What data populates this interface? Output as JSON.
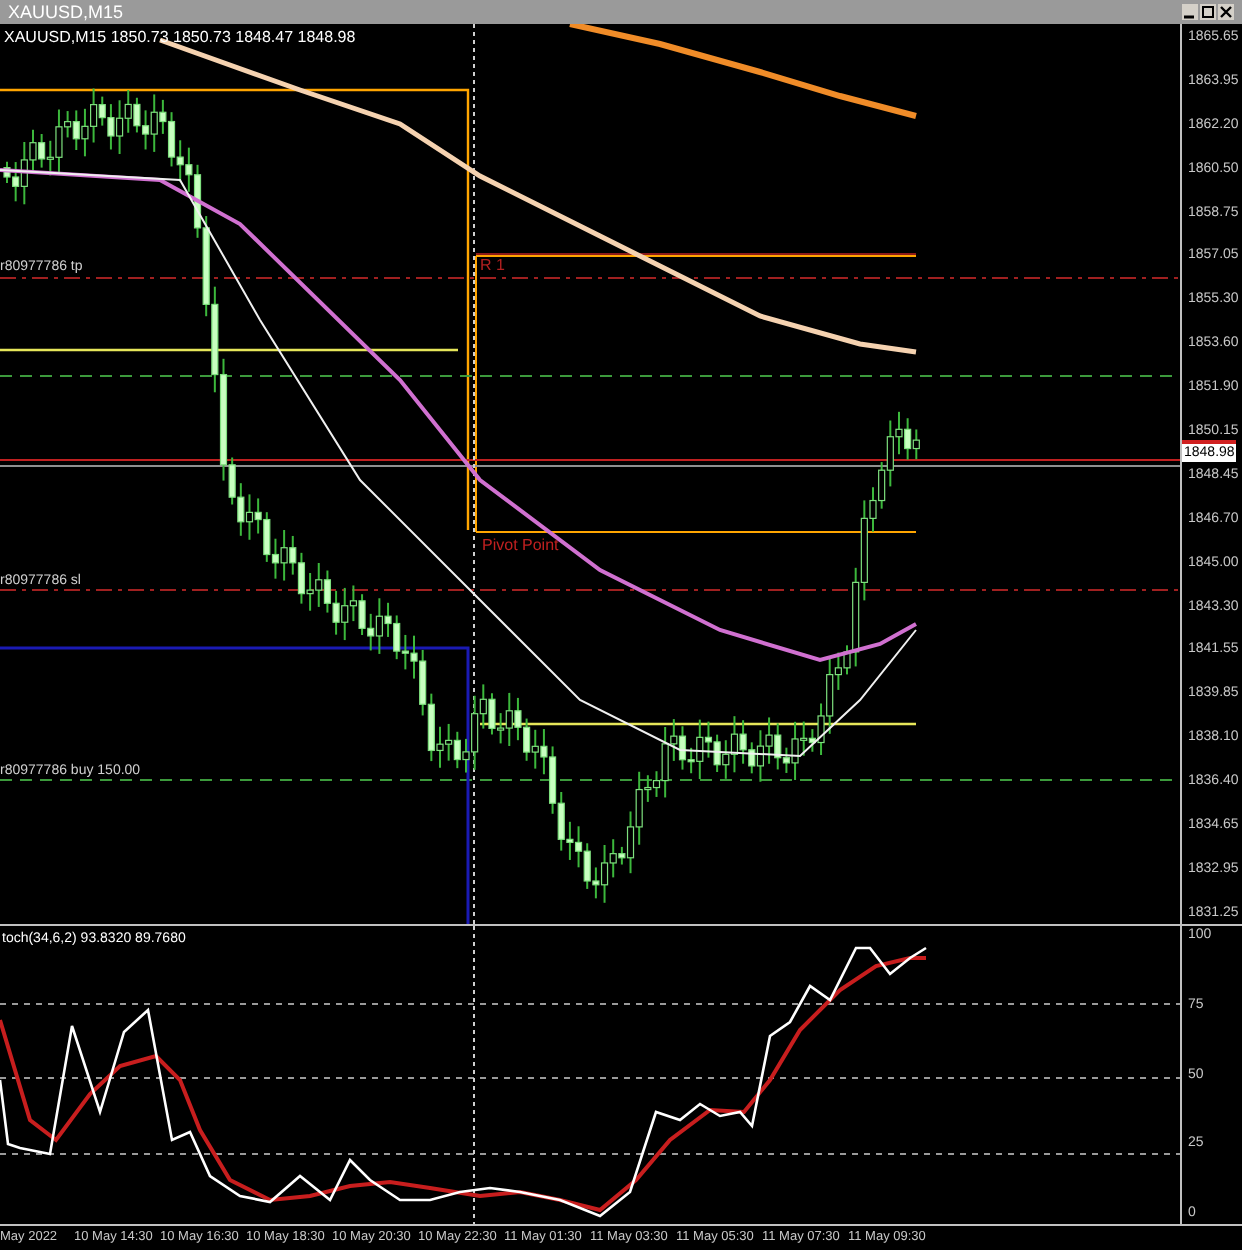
{
  "window": {
    "title": "XAUUSD,M15"
  },
  "chart": {
    "header": "XAUUSD,M15  1850.73 1850.73 1848.47 1848.98",
    "price_labels": [
      "1865.65",
      "1863.95",
      "1862.20",
      "1860.50",
      "1858.75",
      "1857.05",
      "1855.30",
      "1853.60",
      "1851.90",
      "1850.15",
      "1848.45",
      "1846.70",
      "1845.00",
      "1843.30",
      "1841.55",
      "1839.85",
      "1838.10",
      "1836.40",
      "1834.65",
      "1832.95",
      "1831.25"
    ],
    "current_price": "1848.98",
    "tp_label": "r80977786 tp",
    "sl_label": "r80977786 sl",
    "buy_label": "r80977786 buy 150.00",
    "r1_label": "R 1",
    "pivot_label": "Pivot Point"
  },
  "stochastic": {
    "legend": "toch(34,6,2) 93.8320 89.7680",
    "levels": [
      "100",
      "75",
      "50",
      "25",
      "0"
    ]
  },
  "time_axis": [
    "May 2022",
    "10 May 14:30",
    "10 May 16:30",
    "10 May 18:30",
    "10 May 20:30",
    "10 May 22:30",
    "11 May 01:30",
    "11 May 03:30",
    "11 May 05:30",
    "11 May 07:30",
    "11 May 09:30"
  ]
}
